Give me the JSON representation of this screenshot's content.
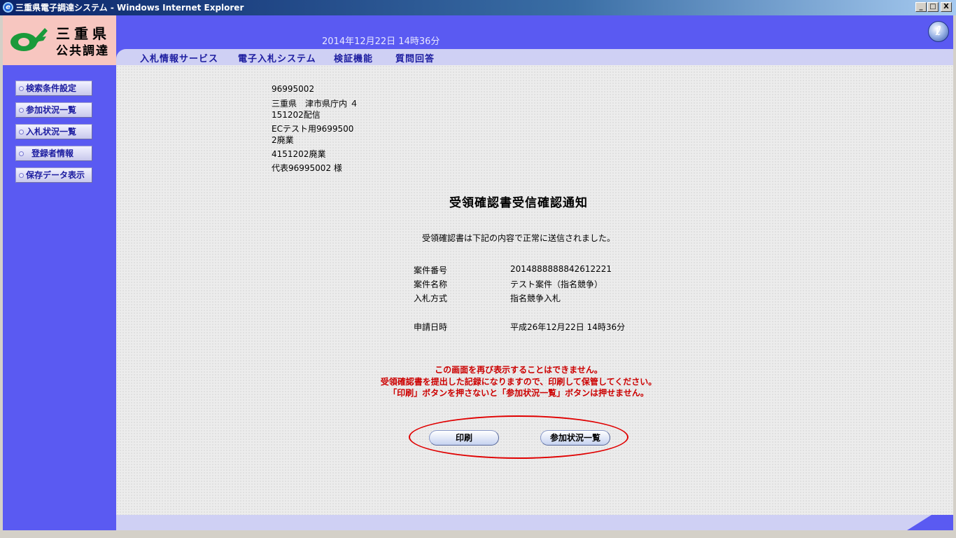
{
  "window": {
    "title": "三重県電子調達システム - Windows Internet Explorer",
    "controls": {
      "minimize": "_",
      "maximize": "□",
      "close": "X"
    }
  },
  "logo": {
    "line1": "三重県",
    "line2": "公共調達",
    "mark_color": "#1a9a3a"
  },
  "header": {
    "datetime": "2014年12月22日 14時36分",
    "help_icon": "help-icon"
  },
  "nav": {
    "items": [
      "入札情報サービス",
      "電子入札システム",
      "検証機能",
      "質問回答"
    ]
  },
  "sidebar": {
    "items": [
      "検索条件設定",
      "参加状況一覧",
      "入札状況一覧",
      "登録者情報",
      "保存データ表示"
    ]
  },
  "address": {
    "code": "96995002",
    "line1": "三重県　津市県庁内 ４",
    "line2": "151202配信",
    "line3": "ECテスト用9699500",
    "line4": "2廃業",
    "line5": "4151202廃業",
    "line6": "代表96995002 様"
  },
  "document": {
    "title": "受領確認書受信確認通知",
    "message": "受領確認書は下記の内容で正常に送信されました。",
    "fields": [
      {
        "label": "案件番号",
        "value": "2014888888842612221"
      },
      {
        "label": "案件名称",
        "value": "テスト案件（指名競争）"
      },
      {
        "label": "入札方式",
        "value": "指名競争入札"
      },
      {
        "label": "申請日時",
        "value": "平成26年12月22日 14時36分"
      }
    ]
  },
  "warnings": [
    "この画面を再び表示することはできません。",
    "受領確認書を提出した記録になりますので、印刷して保管してください。",
    "「印刷」ボタンを押さないと「参加状況一覧」ボタンは押せません。"
  ],
  "actions": {
    "print_label": "印刷",
    "participation_list_label": "参加状況一覧"
  },
  "colors": {
    "frame_blue": "#5a5af2",
    "nav_strip": "#cfd0f4",
    "logo_bg": "#f7c6c0",
    "warning_red": "#cc0000",
    "highlight_ellipse": "#e00000"
  }
}
